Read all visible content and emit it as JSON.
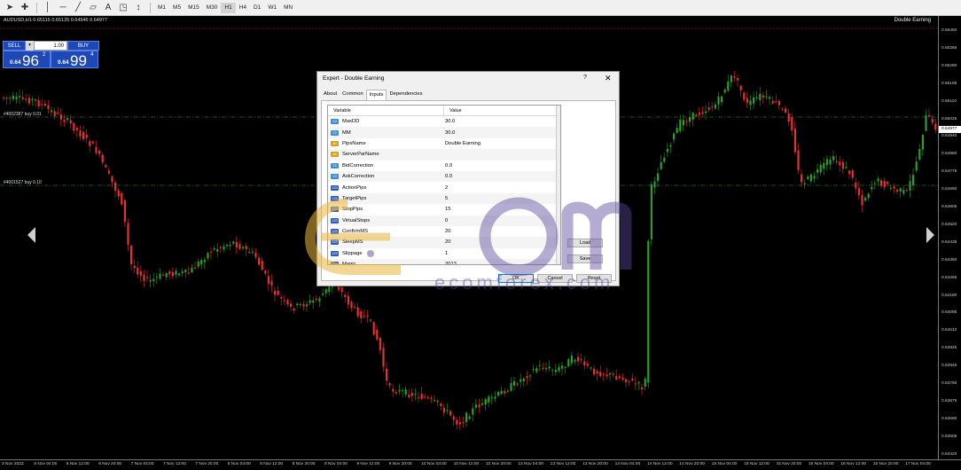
{
  "toolbar": {
    "icons": [
      "cursor-icon",
      "crosshair-icon",
      "vertical-line-icon",
      "horizontal-line-icon",
      "trendline-icon",
      "channel-icon",
      "text-icon",
      "shapes-icon",
      "arrow-icon"
    ],
    "timeframes": [
      "M1",
      "M5",
      "M15",
      "M30",
      "H1",
      "H4",
      "D1",
      "W1",
      "MN"
    ],
    "active_timeframe": "H1"
  },
  "chart": {
    "symbol_info": "AUDUSD,H1  0.65115 0.65125 0.64946 0.64977",
    "ea_name": "Double Earning",
    "order_lines": [
      "#4002387 buy 0.01",
      "#4001527 buy 0.10"
    ],
    "price_scale": [
      "0.65450",
      "0.65365",
      "0.65280",
      "0.65195",
      "0.65110",
      "0.65025",
      "0.64940",
      "0.64860",
      "0.64775",
      "0.64690",
      "0.64605",
      "0.64520",
      "0.64435",
      "0.64350",
      "0.64265",
      "0.64180",
      "0.64095",
      "0.64010",
      "0.63925",
      "0.63845",
      "0.63760",
      "0.63675",
      "0.63590",
      "0.63505",
      "0.63420"
    ],
    "current_price": "0.64977",
    "time_labels": [
      "3 Nov 2023",
      "6 Nov 04:00",
      "6 Nov 12:00",
      "6 Nov 20:00",
      "7 Nov 04:00",
      "7 Nov 12:00",
      "7 Nov 20:00",
      "8 Nov 04:00",
      "8 Nov 12:00",
      "8 Nov 20:00",
      "9 Nov 04:00",
      "9 Nov 12:00",
      "9 Nov 20:00",
      "10 Nov 04:00",
      "10 Nov 12:00",
      "10 Nov 20:00",
      "13 Nov 04:00",
      "13 Nov 12:00",
      "13 Nov 20:00",
      "14 Nov 04:00",
      "14 Nov 12:00",
      "14 Nov 20:00",
      "15 Nov 04:00",
      "15 Nov 12:00",
      "15 Nov 20:00",
      "16 Nov 04:00",
      "16 Nov 12:00",
      "16 Nov 20:00",
      "17 Nov 04:00"
    ],
    "colors": {
      "bull": "#2aa02a",
      "bear": "#e83030",
      "order_line": "#3ca03c",
      "background": "#000000"
    }
  },
  "one_click": {
    "sell_label": "SELL",
    "buy_label": "BUY",
    "volume": "1.00",
    "sell_pre": "0.64",
    "sell_big": "96",
    "sell_sup": "2",
    "buy_pre": "0.64",
    "buy_big": "99",
    "buy_sup": "4"
  },
  "dialog": {
    "title": "Expert - Double Earning",
    "help": "?",
    "close": "✕",
    "tabs": [
      "About",
      "Common",
      "Inputs",
      "Dependencies"
    ],
    "active_tab": "Inputs",
    "col_variable": "Variable",
    "col_value": "Value",
    "rows": [
      {
        "type": "dbl",
        "name": "MaxDD",
        "value": "30.0"
      },
      {
        "type": "dbl",
        "name": "MM",
        "value": "30.0"
      },
      {
        "type": "abc",
        "name": "PipsName",
        "value": "Double Earning"
      },
      {
        "type": "abc",
        "name": "ServerParName",
        "value": ""
      },
      {
        "type": "dbl",
        "name": "BidCorrection",
        "value": "0.0"
      },
      {
        "type": "dbl",
        "name": "AskCorrection",
        "value": "0.0"
      },
      {
        "type": "int",
        "name": "ActionPips",
        "value": "2"
      },
      {
        "type": "int",
        "name": "TargetPips",
        "value": "5"
      },
      {
        "type": "int",
        "name": "StopPips",
        "value": "15"
      },
      {
        "type": "int",
        "name": "VirtualStops",
        "value": "0"
      },
      {
        "type": "int",
        "name": "ConfirmMS",
        "value": "20"
      },
      {
        "type": "int",
        "name": "SleepMS",
        "value": "20"
      },
      {
        "type": "int",
        "name": "Slippage",
        "value": "1"
      },
      {
        "type": "int",
        "name": "Magic",
        "value": "2013"
      }
    ],
    "load_label": "Load",
    "save_label": "Save",
    "ok_label": "OK",
    "cancel_label": "Cancel",
    "reset_label": "Reset"
  },
  "watermark": {
    "text": "ecomforex.com",
    "colors": {
      "gold": "#e8b43c",
      "purple": "#5a4a9a"
    }
  }
}
